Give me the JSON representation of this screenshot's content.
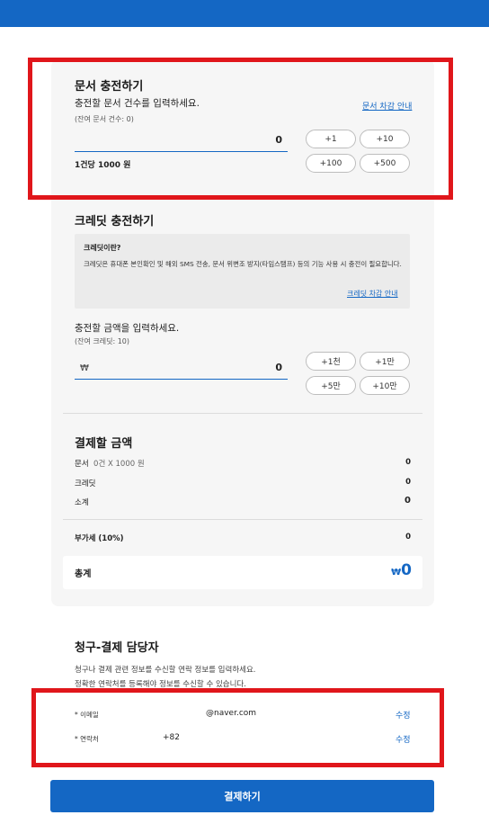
{
  "doc_section": {
    "title": "문서 충전하기",
    "instruction": "충전할 문서 건수를 입력하세요.",
    "remaining": "(잔여 문서 건수: 0)",
    "guide_link": "문서 차감 안내",
    "input_value": "0",
    "unit_price": "1건당 1000 원",
    "buttons": [
      "+1",
      "+10",
      "+100",
      "+500"
    ]
  },
  "credit_section": {
    "title": "크레딧 충전하기",
    "info_title": "크레딧이란?",
    "info_body": "크레딧은 휴대폰 본인확인 및 해외 SMS 전송, 문서 위변조 방지(타임스탬프) 등의 기능 사용 시 충전이 필요합니다.",
    "guide_link": "크레딧 차감 안내",
    "instruction": "충전할 금액을 입력하세요.",
    "remaining": "(잔여 크레딧: 10)",
    "currency_prefix": "₩",
    "input_value": "0",
    "buttons": [
      "+1천",
      "+1만",
      "+5만",
      "+10만"
    ]
  },
  "payment_summary": {
    "title": "결제할 금액",
    "doc_label": "문서",
    "doc_detail": "0건 X 1000 원",
    "doc_value": "0",
    "credit_label": "크레딧",
    "credit_value": "0",
    "subtotal_label": "소계",
    "subtotal_value": "0",
    "vat_label": "부가세 (10%)",
    "vat_value": "0",
    "total_label": "총계",
    "total_currency": "₩",
    "total_value": "0"
  },
  "billing_contact": {
    "title": "청구-결제 담당자",
    "desc_line1": "청구나 결제 관련 정보를 수신할 연락 정보를 입력하세요.",
    "desc_line2": "정확한 연락처를 등록해야 정보를 수신할 수 있습니다.",
    "email_label": "* 이메일",
    "email_value": "@naver.com",
    "phone_label": "* 연락처",
    "phone_value": "+82",
    "edit_label": "수정"
  },
  "pay_button": "결제하기",
  "colors": {
    "accent": "#1467c4",
    "highlight_border": "#e0161b",
    "card_bg": "#f6f6f6"
  }
}
